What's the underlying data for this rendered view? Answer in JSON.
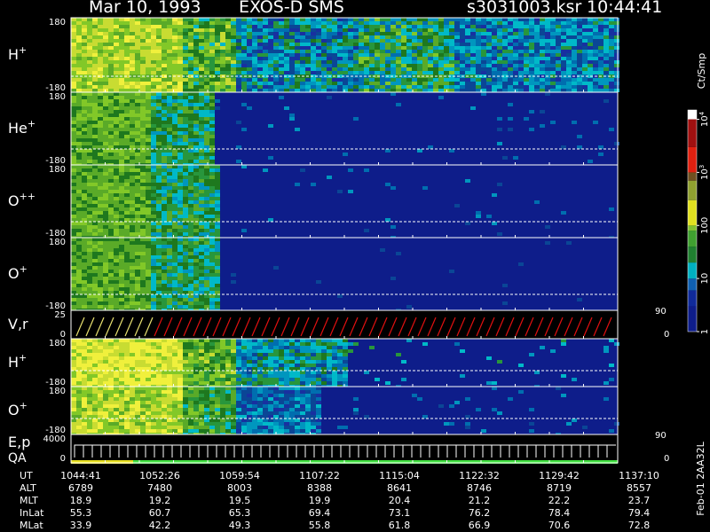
{
  "header": {
    "date": "Mar 10, 1993",
    "instrument": "EXOS-D SMS",
    "file": "s3031003.ksr",
    "time": "10:44:41"
  },
  "colors": {
    "background": "#000000",
    "fill": "#0e1d8a",
    "trace_red": "#e01010",
    "trace_yellow": "#e8e070",
    "ea_green": "#40e040",
    "ea_yellow": "#e8e020"
  },
  "chart_data": {
    "type": "heatmap",
    "panels": [
      {
        "label": "H",
        "sup": "+",
        "ticks": [
          "180",
          "-180"
        ]
      },
      {
        "label": "He",
        "sup": "+",
        "ticks": [
          "180",
          "-180"
        ]
      },
      {
        "label": "O",
        "sup": "++",
        "ticks": [
          "180",
          "-180"
        ]
      },
      {
        "label": "O",
        "sup": "+",
        "ticks": [
          "180",
          "-180"
        ]
      },
      {
        "label": "V,r",
        "sup": "",
        "ticks": [
          "25",
          "0"
        ],
        "right_ticks": [
          "90",
          "0"
        ]
      },
      {
        "label": "H",
        "sup": "+",
        "ticks": [
          "180",
          "-180"
        ]
      },
      {
        "label": "O",
        "sup": "+",
        "ticks": [
          "180",
          "-180"
        ]
      },
      {
        "label": "E,p",
        "label2": "QA",
        "sup": "",
        "ticks": [
          "4000",
          "0"
        ],
        "right_ticks": [
          "90",
          "0"
        ]
      }
    ],
    "colorbar": {
      "label": "Ct/Smp",
      "ticks": [
        {
          "label": "1",
          "value": 1
        },
        {
          "label": "10",
          "value": 10
        },
        {
          "label": "100",
          "value": 100
        },
        {
          "label": "10",
          "sup": "3",
          "value": 1000
        },
        {
          "label": "10",
          "sup": "4",
          "value": 10000
        }
      ],
      "range": [
        1,
        15000
      ],
      "scale": "log"
    },
    "footer": {
      "rows": [
        {
          "label": "UT",
          "values": [
            "1044:41",
            "1052:26",
            "1059:54",
            "1107:22",
            "1115:04",
            "1122:32",
            "1129:42",
            "1137:10"
          ]
        },
        {
          "label": "ALT",
          "values": [
            "6789",
            "7480",
            "8003",
            "8388",
            "8641",
            "8746",
            "8719",
            "8557"
          ]
        },
        {
          "label": "MLT",
          "values": [
            "18.9",
            "19.2",
            "19.5",
            "19.9",
            "20.4",
            "21.2",
            "22.2",
            "23.7"
          ]
        },
        {
          "label": "InLat",
          "values": [
            "55.3",
            "60.7",
            "65.3",
            "69.4",
            "73.1",
            "76.2",
            "78.4",
            "79.4"
          ]
        },
        {
          "label": "MLat",
          "values": [
            "33.9",
            "42.2",
            "49.3",
            "55.8",
            "61.8",
            "66.9",
            "70.6",
            "72.8"
          ]
        }
      ],
      "side_label": "Feb-01  2AA32L"
    }
  }
}
